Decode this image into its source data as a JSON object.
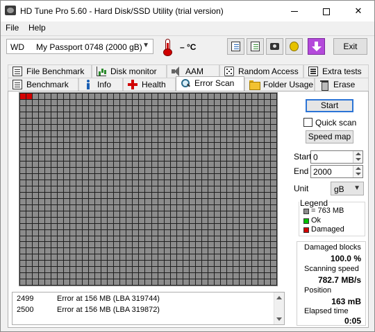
{
  "window": {
    "title": "HD Tune Pro 5.60 - Hard Disk/SSD Utility (trial version)",
    "close_glyph": "✕"
  },
  "menu": {
    "file": "File",
    "help": "Help"
  },
  "toolbar": {
    "drive_brand": "WD",
    "drive_name": "My Passport 0748 (2000 gB)",
    "temperature": "– °C",
    "exit_label": "Exit",
    "buttons": [
      "copy-icon",
      "copy-all-icon",
      "camera-icon",
      "options-icon",
      "download-icon"
    ]
  },
  "tabs": {
    "row1": [
      "File Benchmark",
      "Disk monitor",
      "AAM",
      "Random Access",
      "Extra tests"
    ],
    "row2": [
      "Benchmark",
      "Info",
      "Health",
      "Error Scan",
      "Folder Usage",
      "Erase"
    ],
    "active": "Error Scan"
  },
  "scan": {
    "start_label": "Start",
    "quick_scan_label": "Quick scan",
    "quick_scan_checked": false,
    "speed_map_label": "Speed map",
    "start_field_label": "Start",
    "start_value": "0",
    "end_field_label": "End",
    "end_value": "2000",
    "unit_label": "Unit",
    "unit_value": "gB",
    "grid_damaged_cells": 2
  },
  "legend": {
    "title": "Legend",
    "block_size": "= 763 MB",
    "ok": "Ok",
    "damaged": "Damaged",
    "colors": {
      "block": "#8c8c8c",
      "ok": "#00c000",
      "damaged": "#d40000"
    }
  },
  "stats": {
    "damaged_label": "Damaged blocks",
    "damaged_value": "100.0 %",
    "speed_label": "Scanning speed",
    "speed_value": "782.7 MB/s",
    "position_label": "Position",
    "position_value": "163 mB",
    "elapsed_label": "Elapsed time",
    "elapsed_value": "0:05"
  },
  "log": [
    {
      "num": "2499",
      "msg": "Error at 156 MB (LBA 319744)"
    },
    {
      "num": "2500",
      "msg": "Error at 156 MB (LBA 319872)"
    }
  ]
}
